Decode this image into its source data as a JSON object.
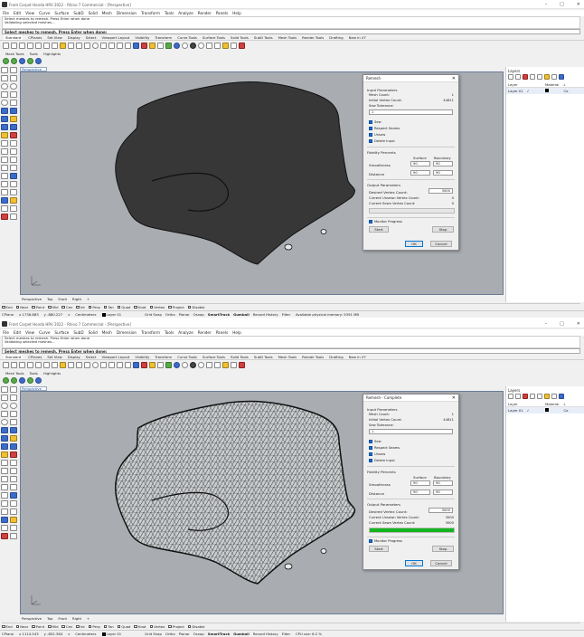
{
  "window1": {
    "title": "Front Carpet Honda HRV 2022 - Rhino 7 Commercial - [Perspective]",
    "menu": [
      "File",
      "Edit",
      "View",
      "Curve",
      "Surface",
      "SubD",
      "Solid",
      "Mesh",
      "Dimension",
      "Transform",
      "Tools",
      "Analyze",
      "Render",
      "Panels",
      "Help"
    ],
    "command_history": [
      "Select meshes to remesh. Press Enter when done",
      "Validating selected meshes..."
    ],
    "command_prompt": "Select meshes to remesh. Press Enter when done:",
    "toolbar_tabs": [
      "Standard",
      "CPlanes",
      "Set View",
      "Display",
      "Select",
      "Viewport Layout",
      "Visibility",
      "Transform",
      "Curve Tools",
      "Surface Tools",
      "Solid Tools",
      "SubD Tools",
      "Mesh Tools",
      "Render Tools",
      "Drafting",
      "New in V7"
    ],
    "mesh_tabs": [
      "Mesh Tools",
      "Tools",
      "Highlights"
    ],
    "viewport_label": "Perspective",
    "viewport_tabs": [
      "Perspective",
      "Top",
      "Front",
      "Right",
      "+"
    ],
    "osnaps": [
      "End",
      "Near",
      "Point",
      "Mid",
      "Cen",
      "Int",
      "Perp",
      "Tan",
      "Quad",
      "Knot",
      "Vertex",
      "Project",
      "Disable"
    ],
    "status": {
      "cplane": "CPlane",
      "x": "x 1736.883",
      "y": "y -880.227",
      "z": "z",
      "units": "Centimeters",
      "layer": "Layer 01",
      "toggles": [
        "Grid Snap",
        "Ortho",
        "Planar",
        "Osnap",
        "SmartTrack",
        "Gumball",
        "Record History",
        "Filter"
      ],
      "memory": "Available physical memory: 5391 MB"
    },
    "layers": {
      "title": "Layers",
      "headers": [
        "Layer",
        "",
        "Material",
        "L"
      ],
      "rows": [
        {
          "name": "Layer 01",
          "check": "✓",
          "mat": "",
          "l": "Co"
        }
      ]
    },
    "dialog": {
      "title": "Remesh",
      "close": "✕",
      "input_header": "Input Parameters",
      "mesh_count_label": "Mesh Count:",
      "mesh_count": "1",
      "initial_vertex_label": "Initial Vertex Count:",
      "initial_vertex": "44811",
      "sew_tolerance_label": "Sew Tolerance:",
      "sew_tolerance": "1",
      "checks": [
        "Sew",
        "Respect Seams",
        "Unsew",
        "Delete Input"
      ],
      "fidelity_header": "Fidelity Percents",
      "surface_col": "Surface",
      "boundary_col": "Boundary",
      "smoothness_label": "Smoothness",
      "smoothness_surface": "90",
      "smoothness_boundary": "90",
      "distance_label": "Distance",
      "distance_surface": "90",
      "distance_boundary": "90",
      "output_header": "Output Parameters",
      "desired_label": "Desired Vertex Count:",
      "desired": "3000",
      "unsewn_label": "Current Unsewn Vertex Count:",
      "unsewn": "0",
      "sewn_label": "Current Sewn Vertex Count:",
      "sewn": "0",
      "progress": 0,
      "monitor_label": "Monitor Progress",
      "start": "Start",
      "stop": "Stop",
      "ok": "OK",
      "cancel": "Cancel"
    }
  },
  "window2": {
    "title": "Front Carpet Honda HRV 2022 - Rhino 7 Commercial - [Perspective]",
    "menu": [
      "File",
      "Edit",
      "View",
      "Curve",
      "Surface",
      "SubD",
      "Solid",
      "Mesh",
      "Dimension",
      "Transform",
      "Tools",
      "Analyze",
      "Render",
      "Panels",
      "Help"
    ],
    "command_history": [
      "Select meshes to remesh. Press Enter when done",
      "Validating selected meshes..."
    ],
    "command_prompt": "Select meshes to remesh. Press Enter when done:",
    "toolbar_tabs": [
      "Standard",
      "CPlanes",
      "Set View",
      "Display",
      "Select",
      "Viewport Layout",
      "Visibility",
      "Transform",
      "Curve Tools",
      "Surface Tools",
      "Solid Tools",
      "SubD Tools",
      "Mesh Tools",
      "Render Tools",
      "Drafting",
      "New in V7"
    ],
    "mesh_tabs": [
      "Mesh Tools",
      "Tools",
      "Highlights"
    ],
    "viewport_label": "Perspective",
    "viewport_tabs": [
      "Perspective",
      "Top",
      "Front",
      "Right",
      "+"
    ],
    "osnaps": [
      "End",
      "Near",
      "Point",
      "Mid",
      "Cen",
      "Int",
      "Perp",
      "Tan",
      "Quad",
      "Knot",
      "Vertex",
      "Project",
      "Disable"
    ],
    "status": {
      "cplane": "CPlane",
      "x": "x 1114.543",
      "y": "y -852.384",
      "z": "z",
      "units": "Centimeters",
      "layer": "Layer 01",
      "toggles": [
        "Grid Snap",
        "Ortho",
        "Planar",
        "Osnap",
        "SmartTrack",
        "Gumball",
        "Record History",
        "Filter"
      ],
      "memory": "CPU use: 6.2 %"
    },
    "layers": {
      "title": "Layers",
      "headers": [
        "Layer",
        "",
        "Material",
        "L"
      ],
      "rows": [
        {
          "name": "Layer 01",
          "check": "✓",
          "mat": "",
          "l": "Co"
        }
      ]
    },
    "dialog": {
      "title": "Remesh - Complete",
      "close": "✕",
      "input_header": "Input Parameters",
      "mesh_count_label": "Mesh Count:",
      "mesh_count": "1",
      "initial_vertex_label": "Initial Vertex Count:",
      "initial_vertex": "44811",
      "sew_tolerance_label": "Sew Tolerance:",
      "sew_tolerance": "1",
      "checks": [
        "Sew",
        "Respect Seams",
        "Unsew",
        "Delete Input"
      ],
      "fidelity_header": "Fidelity Percents",
      "surface_col": "Surface",
      "boundary_col": "Boundary",
      "smoothness_label": "Smoothness",
      "smoothness_surface": "90",
      "smoothness_boundary": "90",
      "distance_label": "Distance",
      "distance_surface": "90",
      "distance_boundary": "90",
      "output_header": "Output Parameters",
      "desired_label": "Desired Vertex Count:",
      "desired": "3000",
      "unsewn_label": "Current Unsewn Vertex Count:",
      "unsewn": "3000",
      "sewn_label": "Current Sewn Vertex Count:",
      "sewn": "3000",
      "progress": 1,
      "monitor_label": "Monitor Progress",
      "start": "Start",
      "stop": "Stop",
      "ok": "OK",
      "cancel": "Cancel"
    }
  }
}
